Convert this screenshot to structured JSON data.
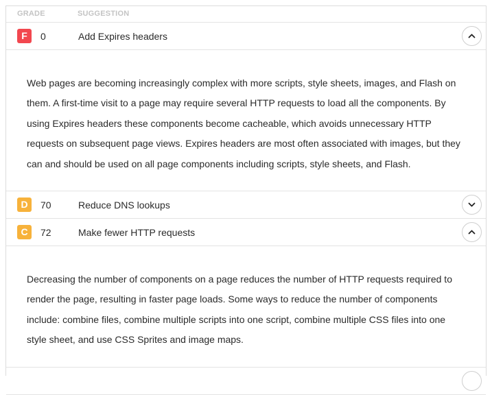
{
  "header": {
    "grade_label": "GRADE",
    "suggestion_label": "SUGGESTION"
  },
  "colors": {
    "grade_F": "#f2474f",
    "grade_D": "#f7b23b",
    "grade_C": "#f7b23b"
  },
  "rows": [
    {
      "grade": "F",
      "score": "0",
      "title": "Add Expires headers",
      "expanded": true,
      "toggle_icon": "chevron-up-icon",
      "description": "Web pages are becoming increasingly complex with more scripts, style sheets, images, and Flash on them. A first-time visit to a page may require several HTTP requests to load all the components. By using Expires headers these components become cacheable, which avoids unnecessary HTTP requests on subsequent page views. Expires headers are most often associated with images, but they can and should be used on all page components including scripts, style sheets, and Flash."
    },
    {
      "grade": "D",
      "score": "70",
      "title": "Reduce DNS lookups",
      "expanded": false,
      "toggle_icon": "chevron-down-icon"
    },
    {
      "grade": "C",
      "score": "72",
      "title": "Make fewer HTTP requests",
      "expanded": true,
      "toggle_icon": "chevron-up-icon",
      "description": "Decreasing the number of components on a page reduces the number of HTTP requests required to render the page, resulting in faster page loads. Some ways to reduce the number of components include: combine files, combine multiple scripts into one script, combine multiple CSS files into one style sheet, and use CSS Sprites and image maps."
    }
  ]
}
